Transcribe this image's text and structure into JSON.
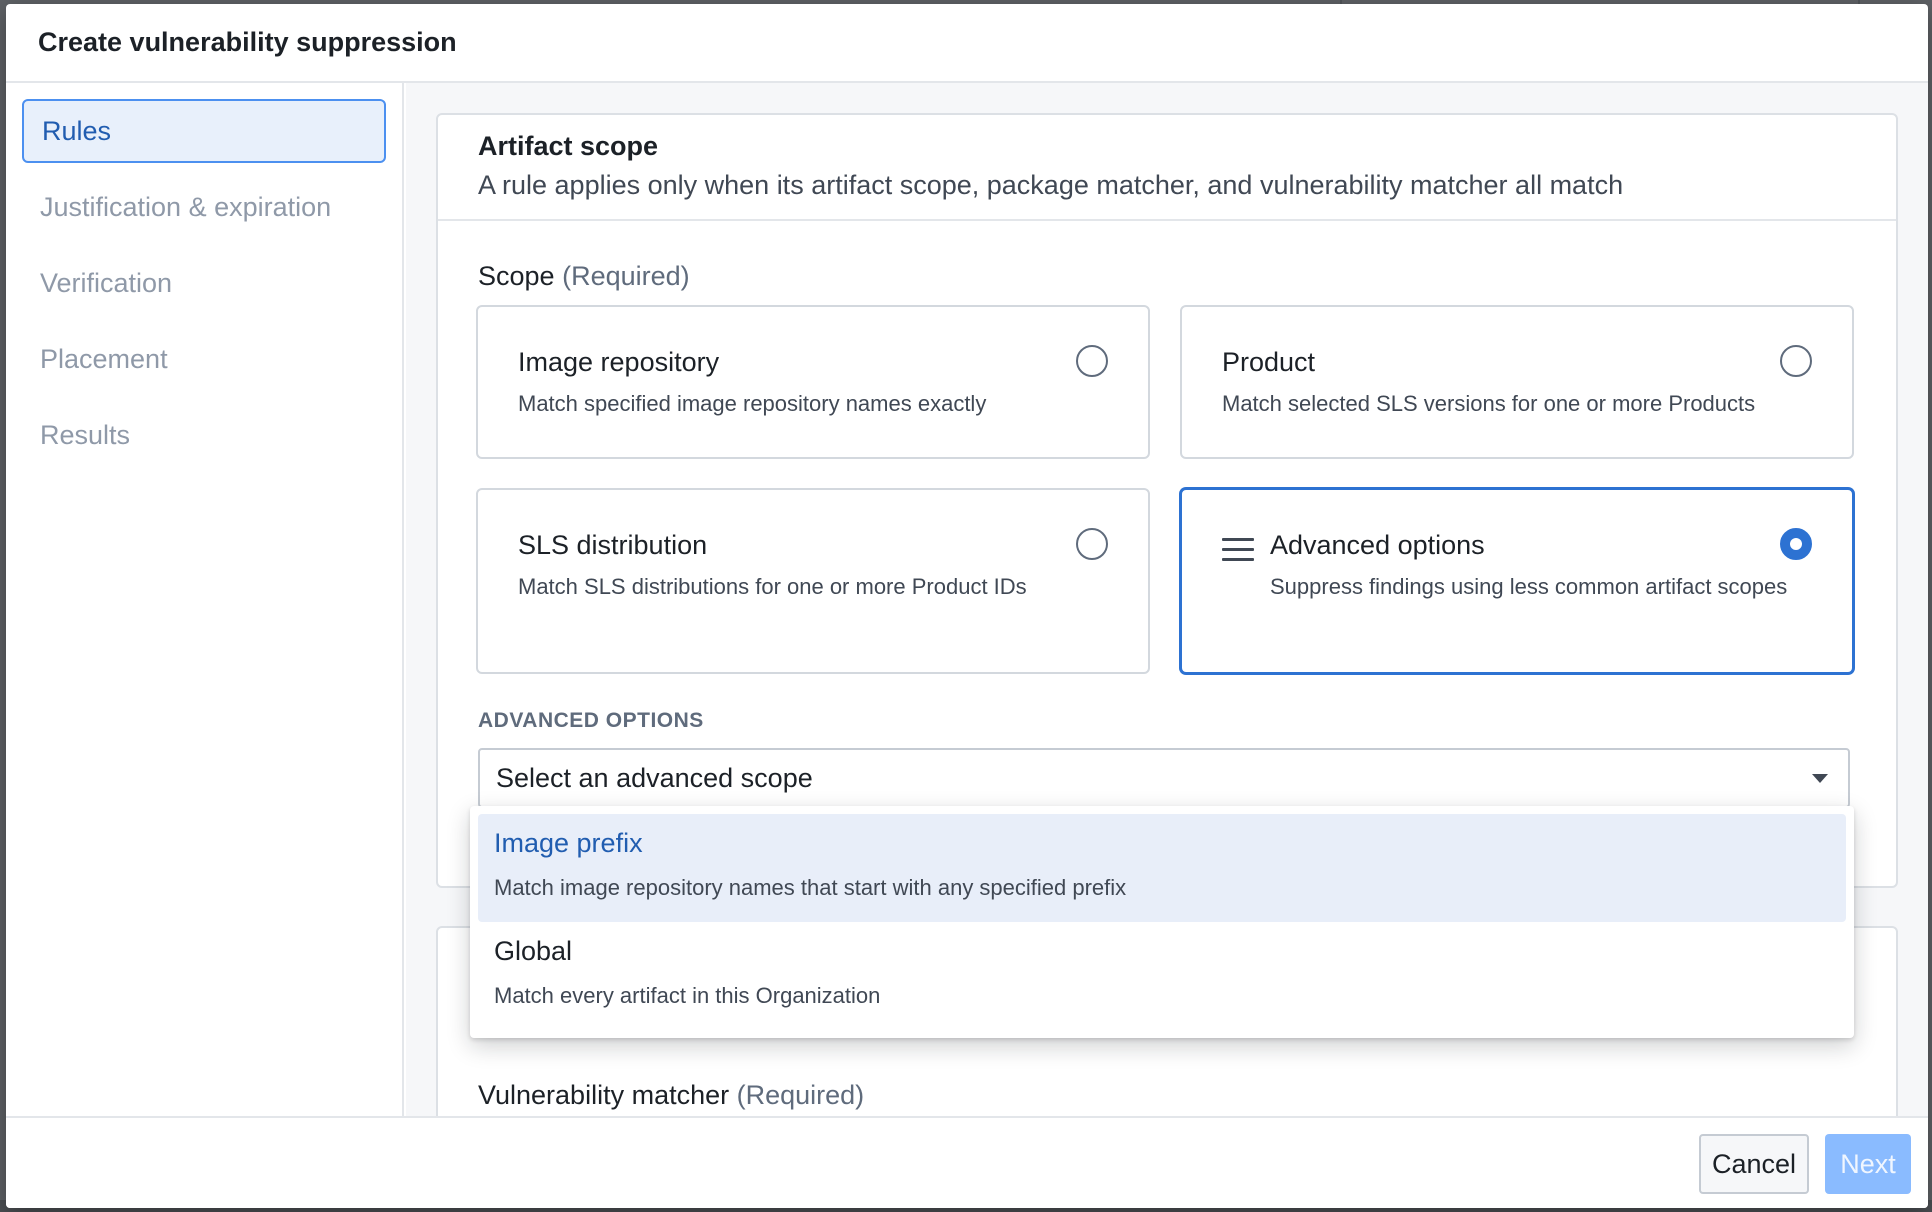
{
  "modal": {
    "title": "Create vulnerability suppression"
  },
  "sidebar": {
    "items": [
      {
        "label": "Rules",
        "active": true
      },
      {
        "label": "Justification & expiration",
        "active": false
      },
      {
        "label": "Verification",
        "active": false
      },
      {
        "label": "Placement",
        "active": false
      },
      {
        "label": "Results",
        "active": false
      }
    ]
  },
  "artifact_scope": {
    "title": "Artifact scope",
    "subtitle": "A rule applies only when its artifact scope, package matcher, and vulnerability matcher all match",
    "scope_label": "Scope",
    "required_label": "(Required)",
    "options": [
      {
        "title": "Image repository",
        "description": "Match specified image repository names exactly",
        "selected": false
      },
      {
        "title": "Product",
        "description": "Match selected SLS versions for one or more Products",
        "selected": false
      },
      {
        "title": "SLS distribution",
        "description": "Match SLS distributions for one or more Product IDs",
        "selected": false
      },
      {
        "title": "Advanced options",
        "description": "Suppress findings using less common artifact scopes",
        "selected": true,
        "icon": "menu-icon"
      }
    ],
    "advanced_label": "ADVANCED OPTIONS",
    "select_placeholder": "Select an advanced scope"
  },
  "dropdown": {
    "items": [
      {
        "title": "Image prefix",
        "description": "Match image repository names that start with any specified prefix",
        "highlighted": true
      },
      {
        "title": "Global",
        "description": "Match every artifact in this Organization",
        "highlighted": false
      }
    ]
  },
  "vulnerability_matcher": {
    "label": "Vulnerability matcher",
    "required_label": "(Required)"
  },
  "footer": {
    "cancel_label": "Cancel",
    "next_label": "Next"
  },
  "colors": {
    "accent": "#2d72d2",
    "active_sidebar_bg": "#e8f0fb",
    "next_disabled": "#8abbff"
  }
}
